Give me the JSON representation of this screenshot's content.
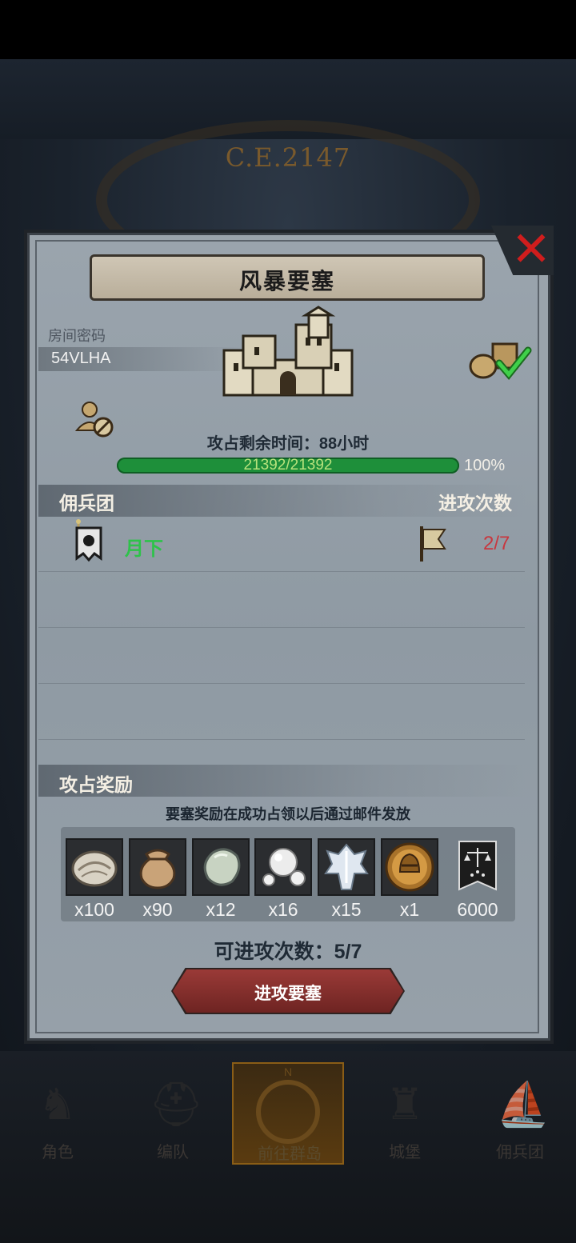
{
  "background": {
    "year": "C.E.2147"
  },
  "dialog": {
    "title": "风暴要塞",
    "close_icon": "close-icon",
    "room_code_label": "房间密码",
    "room_code": "54VLHA",
    "countdown": "攻占剩余时间：88小时",
    "hp_text": "21392/21392",
    "hp_percent": "100%",
    "hp_fraction": 1.0,
    "merc_header": "佣兵团",
    "attack_count_header": "进攻次数",
    "mercenaries": [
      {
        "name": "月下",
        "attacks": "2/7"
      }
    ],
    "reward_header": "攻占奖励",
    "reward_note": "要塞奖励在成功占领以后通过邮件发放",
    "rewards": [
      {
        "icon": "oyster-icon",
        "count": "x100"
      },
      {
        "icon": "pouch-icon",
        "count": "x90"
      },
      {
        "icon": "stone-icon",
        "count": "x12"
      },
      {
        "icon": "pearl-icon",
        "count": "x16"
      },
      {
        "icon": "ice-crystal-icon",
        "count": "x15"
      },
      {
        "icon": "knight-medal-icon",
        "count": "x1"
      },
      {
        "icon": "justice-banner-icon",
        "count": "6000"
      }
    ],
    "attempts": "可进攻次数：5/7",
    "attack_button": "进攻要塞"
  },
  "bottom_nav": {
    "items": [
      {
        "label": "角色",
        "icon": "knight-icon"
      },
      {
        "label": "编队",
        "icon": "helmet-icon"
      },
      {
        "label": "前往群岛",
        "icon": "compass-icon"
      },
      {
        "label": "城堡",
        "icon": "castle-icon"
      },
      {
        "label": "佣兵团",
        "icon": "ship-icon"
      }
    ],
    "active_index": 2,
    "active_color": "#8a5d16"
  },
  "colors": {
    "hp_bar": "#1e8f3a",
    "merc_name": "#2ec24a",
    "attack_count": "#c8373f",
    "close": "#d01d1d",
    "button": "#8a2f2c"
  }
}
